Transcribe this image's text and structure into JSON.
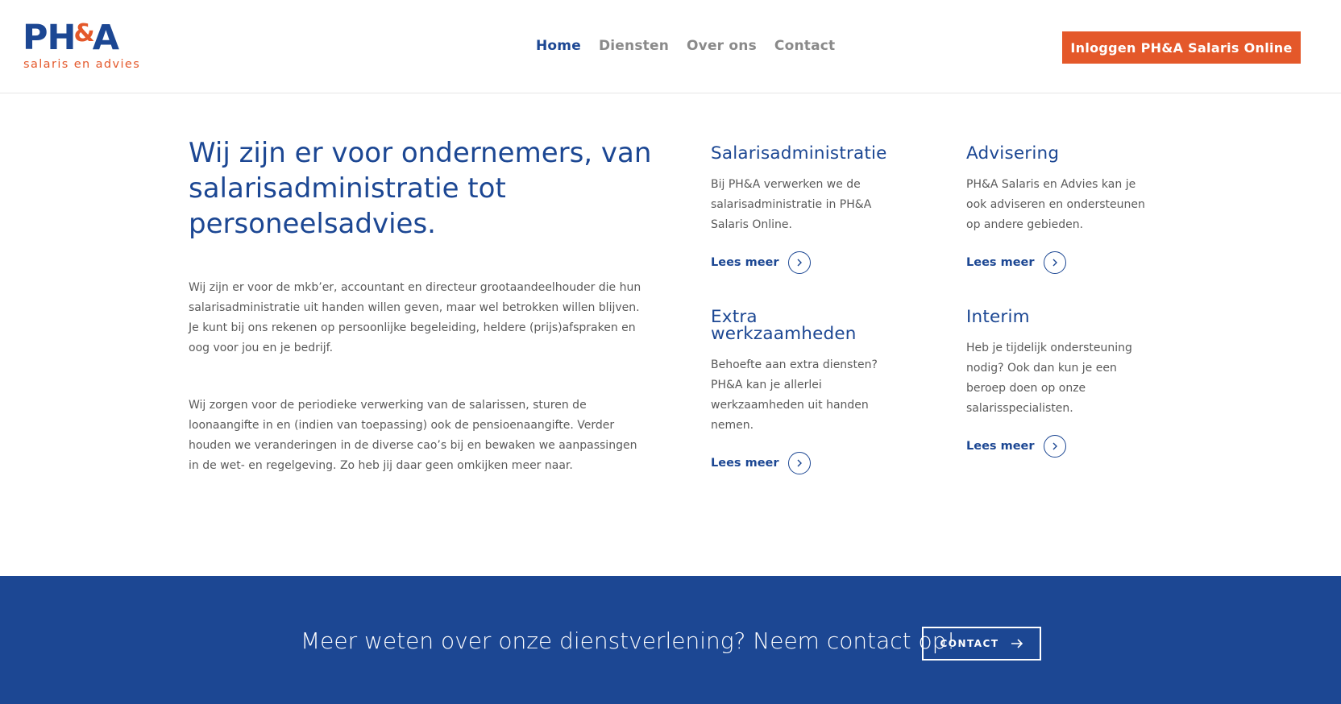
{
  "header": {
    "logo_main_left": "PH",
    "logo_amp": "&",
    "logo_main_right": "A",
    "logo_sub": "salaris en advies",
    "nav": [
      {
        "label": "Home",
        "active": true
      },
      {
        "label": "Diensten",
        "active": false
      },
      {
        "label": "Over ons",
        "active": false
      },
      {
        "label": "Contact",
        "active": false
      }
    ],
    "login_label": "Inloggen PH&A Salaris Online"
  },
  "intro": {
    "headline": "Wij zijn er voor ondernemers, van salarisadministratie tot personeelsadvies.",
    "paragraph1": "Wij zijn er voor de mkb’er, accountant en directeur grootaandeelhouder die hun salarisadministratie uit handen willen geven, maar wel betrokken willen blijven. Je kunt bij ons rekenen op persoonlijke begeleiding, heldere (prijs)afspraken en oog voor jou en je bedrijf.",
    "paragraph2": "Wij zorgen voor de periodieke verwerking van de salarissen, sturen de loonaangifte in en (indien van toepassing) ook de pensioenaangifte. Verder houden we veranderingen in de diverse cao’s bij en bewaken we aanpassingen in de wet- en regelgeving. Zo heb jij daar geen omkijken meer naar."
  },
  "services": [
    {
      "title": "Salarisadministratie",
      "text": "Bij PH&A verwerken we de salarisadministratie in PH&A Salaris Online.",
      "link": "Lees meer"
    },
    {
      "title": "Advisering",
      "text": "PH&A Salaris en Advies kan je ook adviseren en ondersteunen op andere gebieden.",
      "link": "Lees meer"
    },
    {
      "title": "Extra werkzaamheden",
      "text": "Behoefte aan extra diensten? PH&A kan je allerlei werkzaamheden uit handen nemen.",
      "link": "Lees meer"
    },
    {
      "title": "Interim",
      "text": "Heb je tijdelijk ondersteuning nodig? Ook dan kun je een beroep doen op onze salarisspecialisten.",
      "link": "Lees meer"
    }
  ],
  "cta": {
    "text": "Meer weten over onze dienstverlening? Neem contact op!",
    "button": "CONTACT"
  },
  "colors": {
    "brand_blue": "#1c4793",
    "brand_orange": "#e4582a"
  }
}
